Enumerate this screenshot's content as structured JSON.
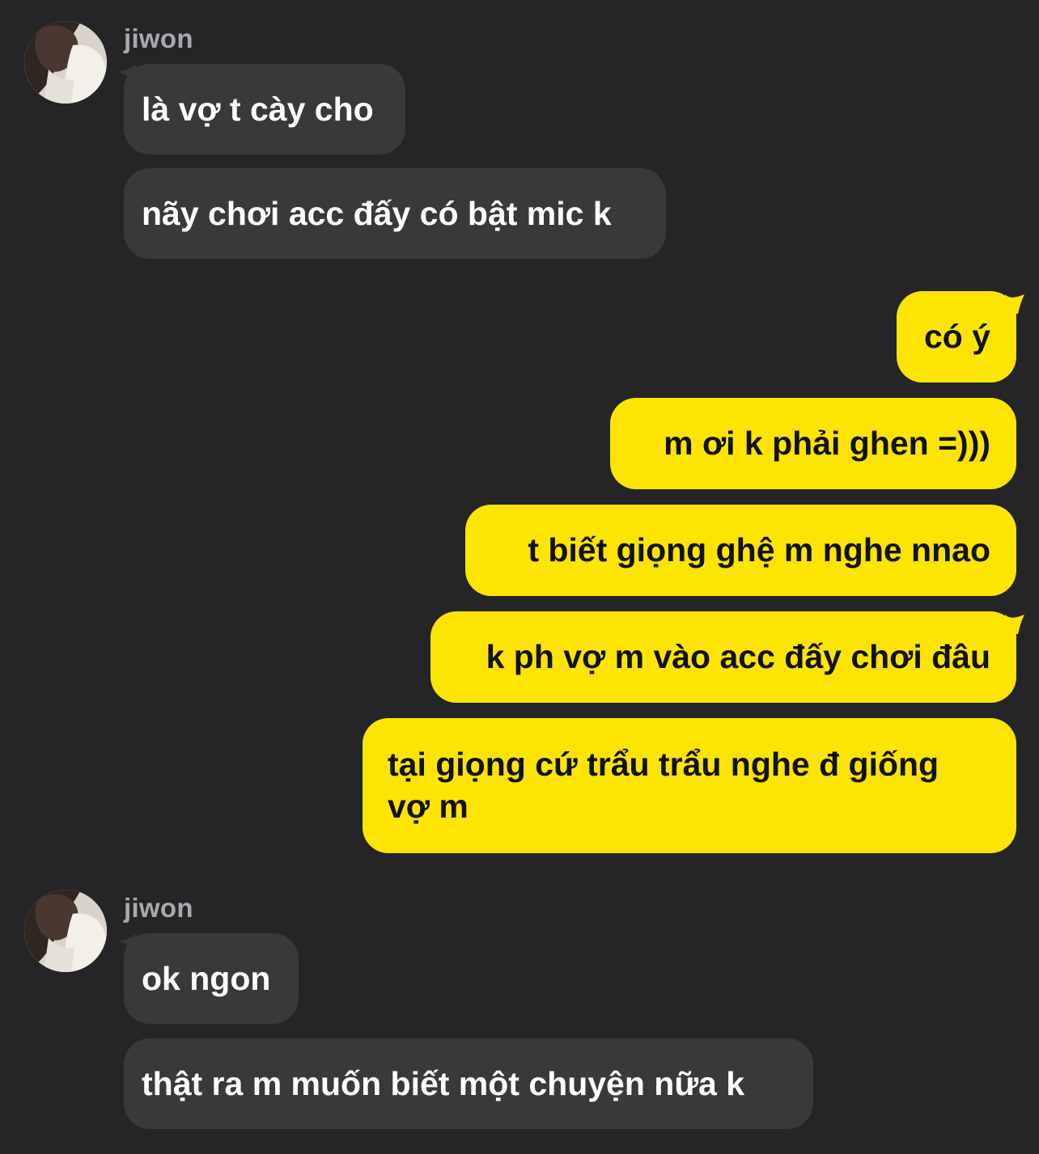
{
  "colors": {
    "background": "#252527",
    "incoming_bubble": "#39393c",
    "outgoing_bubble": "#fde402",
    "sender_name": "#a9a9ad"
  },
  "groups": [
    {
      "direction": "incoming",
      "sender": "jiwon",
      "avatar": "profile-photo",
      "messages": [
        "là vợ t cày cho",
        "nãy chơi acc đấy có bật mic k"
      ]
    },
    {
      "direction": "outgoing",
      "messages": [
        "có ý",
        "m ơi k phải ghen =)))",
        "t biết giọng ghệ m nghe nnao",
        "k ph vợ m vào acc đấy chơi đâu",
        "tại giọng cứ trẩu trẩu nghe đ giống\nvợ m"
      ]
    },
    {
      "direction": "incoming",
      "sender": "jiwon",
      "avatar": "profile-photo",
      "messages": [
        "ok ngon",
        "thật ra m muốn biết một chuyện nữa k"
      ]
    }
  ]
}
